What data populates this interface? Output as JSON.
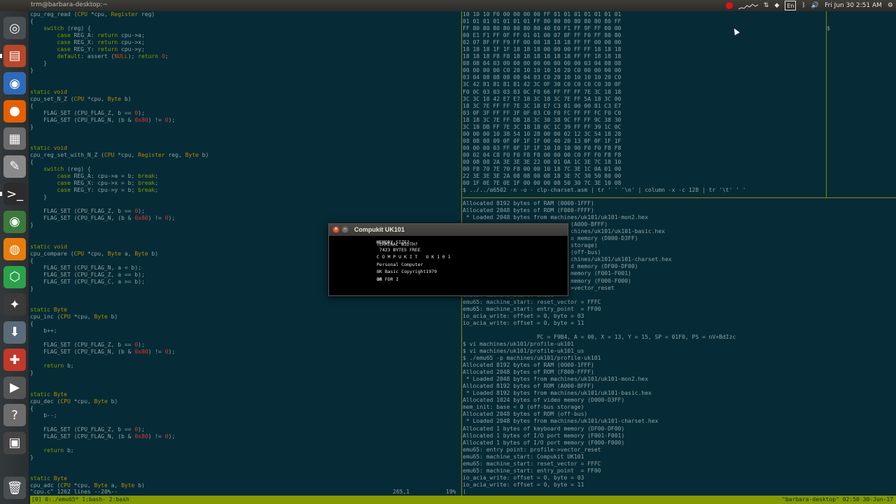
{
  "top_panel": {
    "window_title": "trm@barbara-desktop:~",
    "keyboard_layout": "En",
    "clock": "Fri Jun 30  2:51 AM"
  },
  "launcher": {
    "items": [
      {
        "name": "dash-icon",
        "glyph": "◎",
        "bg": "#4a4f51"
      },
      {
        "name": "files-icon",
        "glyph": "▤",
        "bg": "#b7472a"
      },
      {
        "name": "chromium-icon",
        "glyph": "◉",
        "bg": "#2e6ab8"
      },
      {
        "name": "firefox-icon",
        "glyph": "●",
        "bg": "#e66000"
      },
      {
        "name": "calculator-icon",
        "glyph": "▦",
        "bg": "#6b6b6b"
      },
      {
        "name": "text-editor-icon",
        "glyph": "✎",
        "bg": "#8a8a8a"
      },
      {
        "name": "terminal-icon",
        "glyph": ">_",
        "bg": "#2c2c2c"
      },
      {
        "name": "chrome-icon",
        "glyph": "◉",
        "bg": "#3b7a3b"
      },
      {
        "name": "blender-icon",
        "glyph": "◍",
        "bg": "#e87d0d"
      },
      {
        "name": "app-green-icon",
        "glyph": "⬡",
        "bg": "#2aa24a"
      },
      {
        "name": "inkscape-icon",
        "glyph": "✦",
        "bg": "#3a3a3a"
      },
      {
        "name": "installer-icon",
        "glyph": "⬇",
        "bg": "#5a6b7a"
      },
      {
        "name": "settings-tools-icon",
        "glyph": "✚",
        "bg": "#c0392b"
      },
      {
        "name": "video-editor-icon",
        "glyph": "▶",
        "bg": "#555"
      },
      {
        "name": "help-icon",
        "glyph": "?",
        "bg": "#6d6d6d"
      },
      {
        "name": "workspace-icon",
        "glyph": "▣",
        "bg": "#444"
      },
      {
        "name": "trash-icon",
        "glyph": "🗑",
        "bg": "#4a4f51"
      }
    ]
  },
  "code_pane": {
    "lines": [
      "cpu_reg_read (CPU *cpu, Register reg)",
      "{",
      "    switch (reg) {",
      "        case REG_A: return cpu->a;",
      "        case REG_X: return cpu->x;",
      "        case REG_Y: return cpu->y;",
      "        default: assert (NULL); return 0;",
      "    }",
      "}",
      "",
      "",
      "static void",
      "cpu_set_N_Z (CPU *cpu, Byte b)",
      "{",
      "    FLAG_SET (CPU_FLAG_Z, b == 0);",
      "    FLAG_SET (CPU_FLAG_N, (b & 0x80) != 0);",
      "}",
      "",
      "",
      "static void",
      "cpu_reg_set_with_N_Z (CPU *cpu, Register reg, Byte b)",
      "{",
      "    switch (reg) {",
      "        case REG_A: cpu->a = b; break;",
      "        case REG_X: cpu->x = b; break;",
      "        case REG_Y: cpu->y = b; break;",
      "    }",
      "",
      "    FLAG_SET (CPU_FLAG_Z, b == 0);",
      "    FLAG_SET (CPU_FLAG_N, (b & 0x80) != 0);",
      "}",
      "",
      "",
      "static void",
      "cpu_compare (CPU *cpu, Byte a, Byte b)",
      "{",
      "    FLAG_SET (CPU_FLAG_N, a < b);",
      "    FLAG_SET (CPU_FLAG_Z, a == b);",
      "    FLAG_SET (CPU_FLAG_C, a >= b);",
      "}",
      "",
      "",
      "static Byte",
      "cpu_inc (CPU *cpu, Byte b)",
      "{",
      "    b++;",
      "",
      "    FLAG_SET (CPU_FLAG_Z, b == 0);",
      "    FLAG_SET (CPU_FLAG_N, (b & 0x80) != 0);",
      "",
      "    return b;",
      "}",
      "",
      "",
      "static Byte",
      "cpu_dec (CPU *cpu, Byte b)",
      "{",
      "    b--;",
      "",
      "    FLAG_SET (CPU_FLAG_Z, b == 0);",
      "    FLAG_SET (CPU_FLAG_N, (b & 0x80) != 0);",
      "",
      "    return b;",
      "}",
      "",
      "",
      "static Byte",
      "cpu_adc (CPU *cpu, Byte a, Byte b)"
    ],
    "status_left": "\"cpu.c\" 1262 lines --20%--",
    "status_pos": "265,1",
    "status_pct": "19%"
  },
  "hex_pane": {
    "lines": [
      "10 10 10 F0 00 00 00 00 FF 01 01 01 01 01 01 01",
      "01 01 01 01 01 01 01 FF 80 80 80 80 80 80 80 FF",
      "FF 80 80 80 80 80 80 80 40 E0 F1 FF 9F FF 00 00",
      "00 E1 F1 FF 0F FF 01 01 00 07 8F FF F0 FF 80 80",
      "02 07 8F FF F9 FF 00 00 18 18 18 FF FF 00 00 00",
      "18 18 18 1F 1F 18 18 18 00 00 00 FF FF 18 18 18",
      "18 18 18 F8 F8 18 18 18 18 18 18 FF FF 18 18 18",
      "08 08 04 03 00 00 00 00 00 00 00 00 03 04 08 08",
      "00 00 00 00 C0 20 10 10 10 10 20 C0 00 00 00 00",
      "03 04 08 08 08 08 04 03 C0 20 10 10 10 10 20 C0",
      "3C 42 81 81 81 81 42 3C 0F 30 C0 C0 C0 C0 30 0F",
      "F0 0C 03 03 03 03 0C F0 66 FF FF FF 7E 3C 18 18",
      "3C 3C 18 42 E7 E7 18 3C 18 3C 7E FF 5A 18 3C 00",
      "18 3C 7E FF FF 7E 3C 18 E7 C3 81 00 00 81 C3 E7",
      "03 0F 3F FF FF 3F 0F 03 C0 F0 FC FF FF FC F0 C0",
      "18 18 3C 7E FF DB 18 3C 30 38 9C FF FF 9C 38 30",
      "3C 18 DB FF 7E 3C 18 18 0C 1C 39 FF FF 39 1C 0C",
      "00 00 00 10 38 54 10 28 00 00 02 12 3C 54 18 28",
      "08 08 08 09 0F 0F 1F 1F 00 40 20 13 0F 0F 1F 1F",
      "00 00 00 03 FF 0F 1F 1F 10 10 10 90 F0 F0 F8 F8",
      "00 02 04 C8 F0 F0 F8 F8 00 00 00 C0 FF F0 F8 F8",
      "00 08 08 2A 3E 3E 3E 22 00 01 0A 1C 3E 7C 18 10",
      "00 F8 70 7E 70 F8 00 00 10 18 7C 3E 1C 0A 01 00",
      "22 3E 3E 3E 2A 08 08 00 08 18 3E 7C 30 50 80 00",
      "00 1F 0E 7E 0E 1F 00 00 00 08 50 30 7C 3E 10 08",
      "$ ../../a6502 -n -o - clp-charset.asm | tr ' ' '\\n' | column -x -c 128 | tr '\\t' ' '"
    ]
  },
  "side_pane": {
    "prompt": "$"
  },
  "log_pane": {
    "lines": [
      "Allocated 8192 bytes of RAM (0000-1FFF)",
      "Allocated 2048 bytes of ROM (F800-FFFF)",
      " * Loaded 2048 bytes from machines/uk101/uk101-mon2.hex",
      "                                (A000-BFFF)",
      "                                chines/uk101/uk101-basic.hex",
      "                                o memory (D000-D3FF)",
      "                                storage)",
      "                                (off-bus)",
      "                                chines/uk101/uk101-charset.hex",
      "                                d memory (DF00-DF00)",
      "                                memory (F001-F001)",
      "                                memory (F000-F000)",
      "                                >vector_reset",
      "emu65: machine_start: UK101",
      "emu65: machine_start: reset_vector = FFFC",
      "emu65: machine_start: entry_point  = FF00",
      "io_acia_write: offset = 0, byte = 03",
      "io_acia_write: offset = 0, byte = 11",
      "",
      "                      PC = F9B4, A = 00, X = 13, Y = 15, SP = 01F0, PS = nV+BdIzc",
      "$ vi machines/uk101/profile-uk101",
      "$ vi machines/uk101/profile-uk101_us",
      "$ ./emu65 -p machines/uk101/profile-uk101",
      "Allocated 8192 bytes of RAM (0000-1FFF)",
      "Allocated 2048 bytes of ROM (F800-FFFF)",
      " * Loaded 2048 bytes from machines/uk101/uk101-mon2.hex",
      "Allocated 8192 bytes of ROM (A000-BFFF)",
      " * Loaded 8192 bytes from machines/uk101/uk101-basic.hex",
      "Allocated 1024 bytes of video memory (D000-D3FF)",
      "mem_init: base < 0 (off-bus storage)",
      "Allocated 2048 bytes of ROM (off-bus)",
      " * Loaded 2048 bytes from machines/uk101/uk101-charset.hex",
      "Allocated 1 bytes of keyboard memory (DF00-DF00)",
      "Allocated 1 bytes of I/O port memory (F001-F001)",
      "Allocated 1 bytes of I/O port memory (F000-F000)",
      "emu65: entry point: profile->vector_reset",
      "emu65: machine_start: Compukit UK101",
      "emu65: machine_start: reset_vector = FFFC",
      "emu65: machine_start: entry_point  = FF00",
      "io_acia_write: offset = 0, byte = 03",
      "io_acia_write: offset = 0, byte = 11",
      "|"
    ]
  },
  "emulator": {
    "title": "Compukit UK101",
    "close_glyph": "×",
    "min_glyph": "–",
    "screen_lines": [
      "MEMORY SIZE?",
      " 7423 BYTES FREE",
      "C O M P U K I T   U K 1 0 1",
      "Personal Computer",
      "8K Basic Copyright1979",
      "10 FOR I"
    ],
    "overlay_line": "TERMINAL WIDTH?",
    "overlay_ok": "OK"
  },
  "tmux": {
    "left": "[0] 0:./emu65* 1:bash- 2:bash",
    "right": "\"barbara-desktop\" 02:50 30-Jun-17"
  }
}
